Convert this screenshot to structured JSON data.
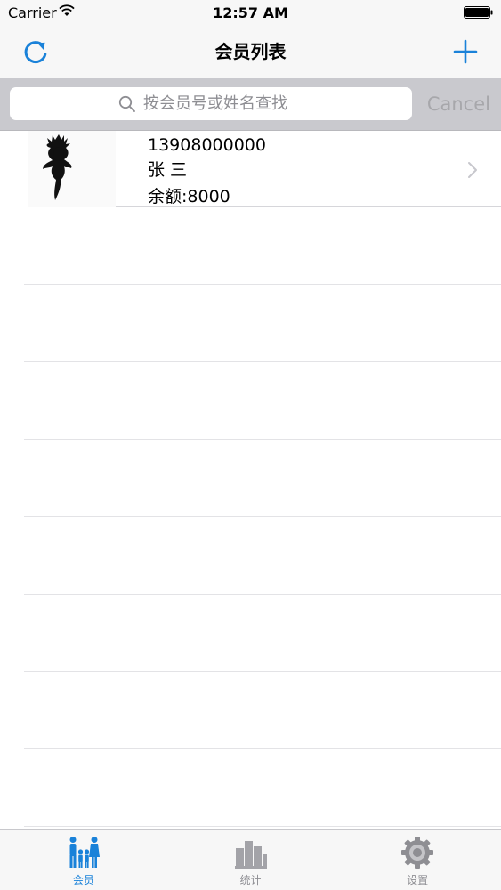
{
  "status_bar": {
    "carrier": "Carrier",
    "time": "12:57 AM"
  },
  "nav": {
    "title": "会员列表",
    "left_icon": "refresh-icon",
    "right_icon": "plus-icon"
  },
  "search": {
    "placeholder": "按会员号或姓名查找",
    "cancel_label": "Cancel"
  },
  "members": [
    {
      "phone": "13908000000",
      "name": "张 三",
      "balance": "余额:8000",
      "avatar_icon": "lizard-avatar-icon"
    }
  ],
  "tabs": [
    {
      "label": "会员",
      "icon": "members-icon",
      "active": true
    },
    {
      "label": "统计",
      "icon": "stats-icon",
      "active": false
    },
    {
      "label": "设置",
      "icon": "settings-gear-icon",
      "active": false
    }
  ],
  "colors": {
    "accent": "#1a82d9",
    "bar_background": "#f7f7f7",
    "search_bar_background": "#c9c9ce",
    "inactive": "#8e8e93"
  }
}
